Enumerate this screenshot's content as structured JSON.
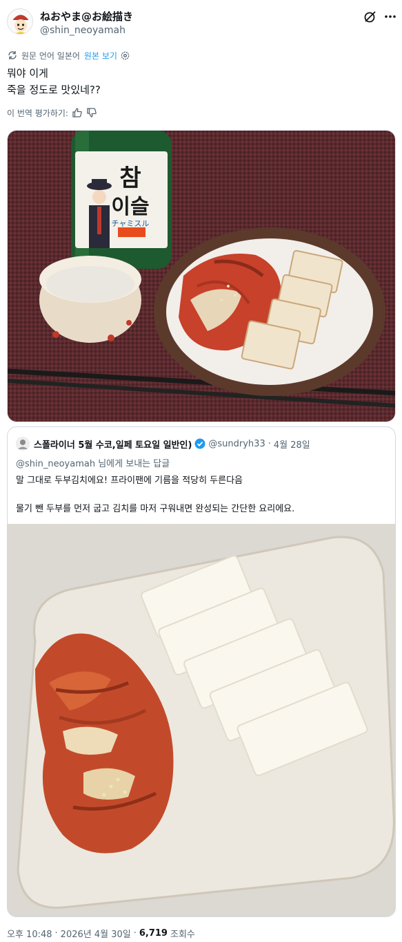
{
  "author": {
    "display_name": "ねおやま@お絵描き",
    "handle": "@shin_neoyamah"
  },
  "translation": {
    "note": "원문 언어 일본어",
    "show_original": "원본 보기"
  },
  "tweet": {
    "line1": "뭐야 이게",
    "line2": "죽을 정도로 맛있네??"
  },
  "rate": {
    "label": "이 번역 평가하기:"
  },
  "photo1": {
    "bottle_label_top": "참",
    "bottle_label_bottom": "이슬",
    "bottle_label_sub": "チャミスル"
  },
  "quote": {
    "display_name": "스폴라이너 5월 수코,일페 토요일 일반인)",
    "handle": "@sundryh33",
    "separator": "·",
    "date": "4월 28일",
    "reply_mention": "@shin_neoyamah",
    "reply_suffix": " 님에게 보내는 답글",
    "text_line1": "말 그대로 두부김치에요! 프라이팬에 기름을 적당히 두른다음",
    "text_line2": "물기 뺀 두부를 먼저 굽고 김치를 마저 구워내면 완성되는 간단한 요리에요."
  },
  "footer": {
    "time": "오후 10:48",
    "sep1": "·",
    "date": "2026년 4월 30일",
    "sep2": "·",
    "views_count": "6,719",
    "views_label": "조회수"
  },
  "colors": {
    "accent": "#1d9bf0",
    "muted": "#536471",
    "text": "#0f1419"
  }
}
